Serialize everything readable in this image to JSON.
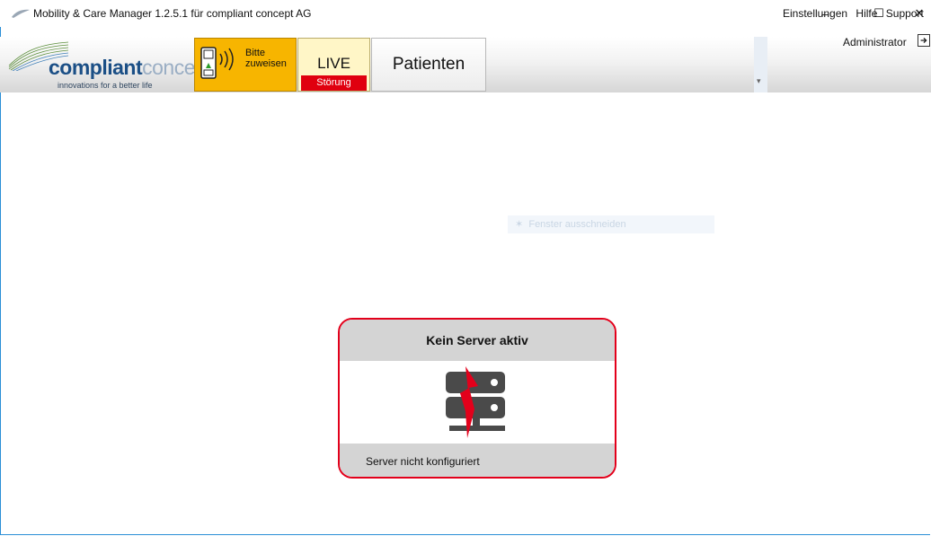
{
  "window": {
    "title": "Mobility & Care Manager 1.2.5.1 für compliant concept AG",
    "controls": {
      "minimize": "–",
      "maximize": "☐",
      "close": "✕"
    }
  },
  "logo": {
    "word_bold": "compliant",
    "word_light": "concept",
    "tagline": "innovations for a better life"
  },
  "toolbar": {
    "assign": {
      "line1": "Bitte",
      "line2": "zuweisen",
      "color": "#f7b500"
    },
    "live": {
      "label": "LIVE",
      "status": "Störung",
      "status_color": "#e0000f"
    },
    "patients": {
      "label": "Patienten"
    }
  },
  "menu": {
    "items": [
      "Einstellungen",
      "Hilfe",
      "Support"
    ],
    "user": "Administrator"
  },
  "ghost_popup": {
    "label": "Fenster ausschneiden"
  },
  "server_card": {
    "title": "Kein Server aktiv",
    "message": "Server nicht konfiguriert",
    "border_color": "#e3001b",
    "icon": "server-error-icon"
  }
}
